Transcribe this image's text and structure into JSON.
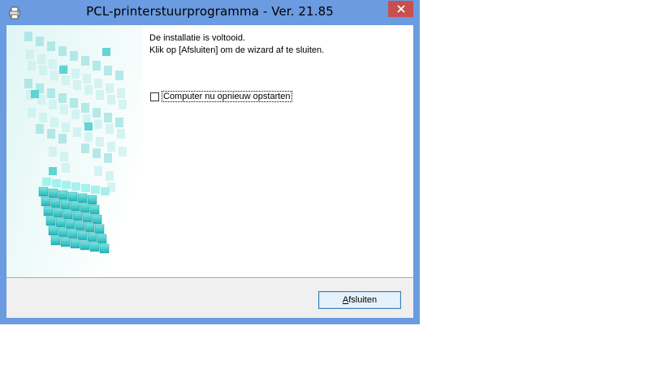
{
  "window": {
    "title": "PCL-printerstuurprogramma - Ver. 21.85",
    "close_icon": "close-icon",
    "app_icon": "printer-installer-icon"
  },
  "content": {
    "message_line1": "De installatie is voltooid.",
    "message_line2": "Klik op [Afsluiten] om de wizard af te sluiten.",
    "restart_checkbox": {
      "label": "Computer nu opnieuw opstarten",
      "checked": false
    }
  },
  "footer": {
    "finish_button": {
      "label_first": "A",
      "label_rest": "fsluiten"
    }
  },
  "colors": {
    "frame": "#6b9be0",
    "close_button": "#c7504f",
    "cube_accent": "#2ec8c8",
    "button_border": "#3c7fb1"
  }
}
